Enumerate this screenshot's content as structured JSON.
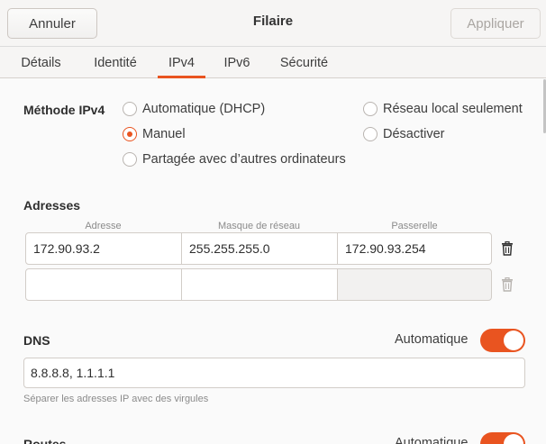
{
  "header": {
    "cancel_label": "Annuler",
    "title": "Filaire",
    "apply_label": "Appliquer"
  },
  "tabs": [
    {
      "label": "Détails",
      "active": false
    },
    {
      "label": "Identité",
      "active": false
    },
    {
      "label": "IPv4",
      "active": true
    },
    {
      "label": "IPv6",
      "active": false
    },
    {
      "label": "Sécurité",
      "active": false
    }
  ],
  "ipv4": {
    "method_label": "Méthode IPv4",
    "methods": [
      {
        "label": "Automatique (DHCP)",
        "checked": false
      },
      {
        "label": "Réseau local seulement",
        "checked": false
      },
      {
        "label": "Manuel",
        "checked": true
      },
      {
        "label": "Désactiver",
        "checked": false
      },
      {
        "label": "Partagée avec d’autres ordinateurs",
        "checked": false
      }
    ]
  },
  "addresses": {
    "section_label": "Adresses",
    "columns": [
      "Adresse",
      "Masque de réseau",
      "Passerelle"
    ],
    "rows": [
      [
        "172.90.93.2",
        "255.255.255.0",
        "172.90.93.254"
      ],
      [
        "",
        "",
        ""
      ]
    ]
  },
  "dns": {
    "section_label": "DNS",
    "auto_label": "Automatique",
    "auto_enabled": true,
    "value": "8.8.8.8, 1.1.1.1",
    "hint": "Séparer les adresses IP avec des virgules"
  },
  "routes": {
    "section_label": "Routes",
    "auto_label": "Automatique",
    "auto_enabled": true
  },
  "colors": {
    "accent": "#e95420",
    "border": "#d2cdc8",
    "header_bg": "#f6f5f4"
  },
  "icons": [
    "trash-icon"
  ]
}
